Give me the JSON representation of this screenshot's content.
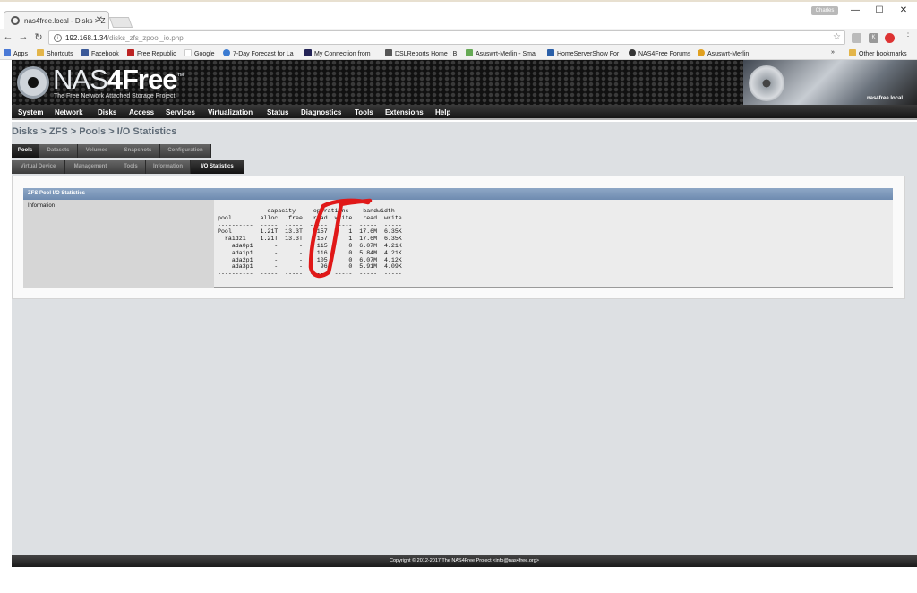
{
  "browser": {
    "tab_title": "nas4free.local - Disks > Z",
    "user_chip": "Charles",
    "url_host": "192.168.1.34",
    "url_path": "/disks_zfs_zpool_io.php",
    "bookmarks": [
      "Apps",
      "Shortcuts",
      "Facebook",
      "Free Republic",
      "Google",
      "7-Day Forecast for La",
      "My Connection from",
      "DSLReports Home : B",
      "Asuswrt-Merlin - Sma",
      "HomeServerShow For",
      "NAS4Free Forums",
      "Asuswrt-Merlin"
    ],
    "overflow": "»",
    "other_bookmarks": "Other bookmarks"
  },
  "header": {
    "logo_prefix": "NAS",
    "logo_bold": "4Free",
    "tm": "™",
    "tagline": "The Free Network Attached Storage Project",
    "hostname": "nas4free.local"
  },
  "menu": [
    "System",
    "Network",
    "Disks",
    "Access",
    "Services",
    "Virtualization",
    "Status",
    "Diagnostics",
    "Tools",
    "Extensions",
    "Help"
  ],
  "breadcrumb": "Disks > ZFS > Pools > I/O Statistics",
  "tabs_top": [
    "Pools",
    "Datasets",
    "Volumes",
    "Snapshots",
    "Configuration"
  ],
  "tabs_sub": [
    "Virtual Device",
    "Management",
    "Tools",
    "Information",
    "I/O Statistics"
  ],
  "panel": {
    "title": "ZFS Pool I/O Statistics",
    "label": "Information",
    "stats": "              capacity     operations    bandwidth\npool        alloc   free   read  write   read  write\n----------  -----  -----  -----  -----  -----  -----\nPool        1.21T  13.3T    157      1  17.6M  6.35K\n  raidz1    1.21T  13.3T    157      1  17.6M  6.35K\n    ada0p1      -      -    115      0  6.07M  4.21K\n    ada1p1      -      -    116      0  5.84M  4.21K\n    ada2p1      -      -    105      0  6.07M  4.12K\n    ada3p1      -      -     96      0  5.91M  4.09K\n----------  -----  -----  -----  -----  -----  -----"
  },
  "footer": "Copyright © 2012-2017 The NAS4Free Project <info@nas4free.org>"
}
